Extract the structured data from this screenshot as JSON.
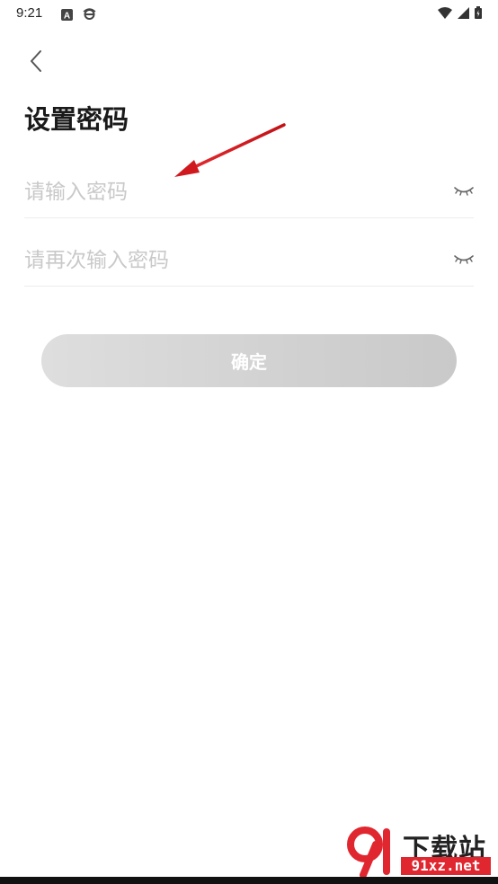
{
  "status_bar": {
    "time": "9:21",
    "left_icons": [
      "a-app-icon",
      "ie-browser-icon"
    ],
    "right_icons": [
      "wifi-icon",
      "signal-icon",
      "battery-icon"
    ]
  },
  "header": {
    "back_icon": "chevron-left-icon",
    "title": "设置密码"
  },
  "form": {
    "password_placeholder": "请输入密码",
    "password_value": "",
    "confirm_placeholder": "请再次输入密码",
    "confirm_value": "",
    "eye_icon": "closed-eye-icon",
    "submit_label": "确定"
  },
  "watermark": {
    "text": "下载站",
    "url": "91xz.net"
  },
  "colors": {
    "accent_arrow": "#d0191f",
    "button_bg": "#d3d3d3",
    "placeholder": "#c9c9c9",
    "divider": "#ececec"
  }
}
